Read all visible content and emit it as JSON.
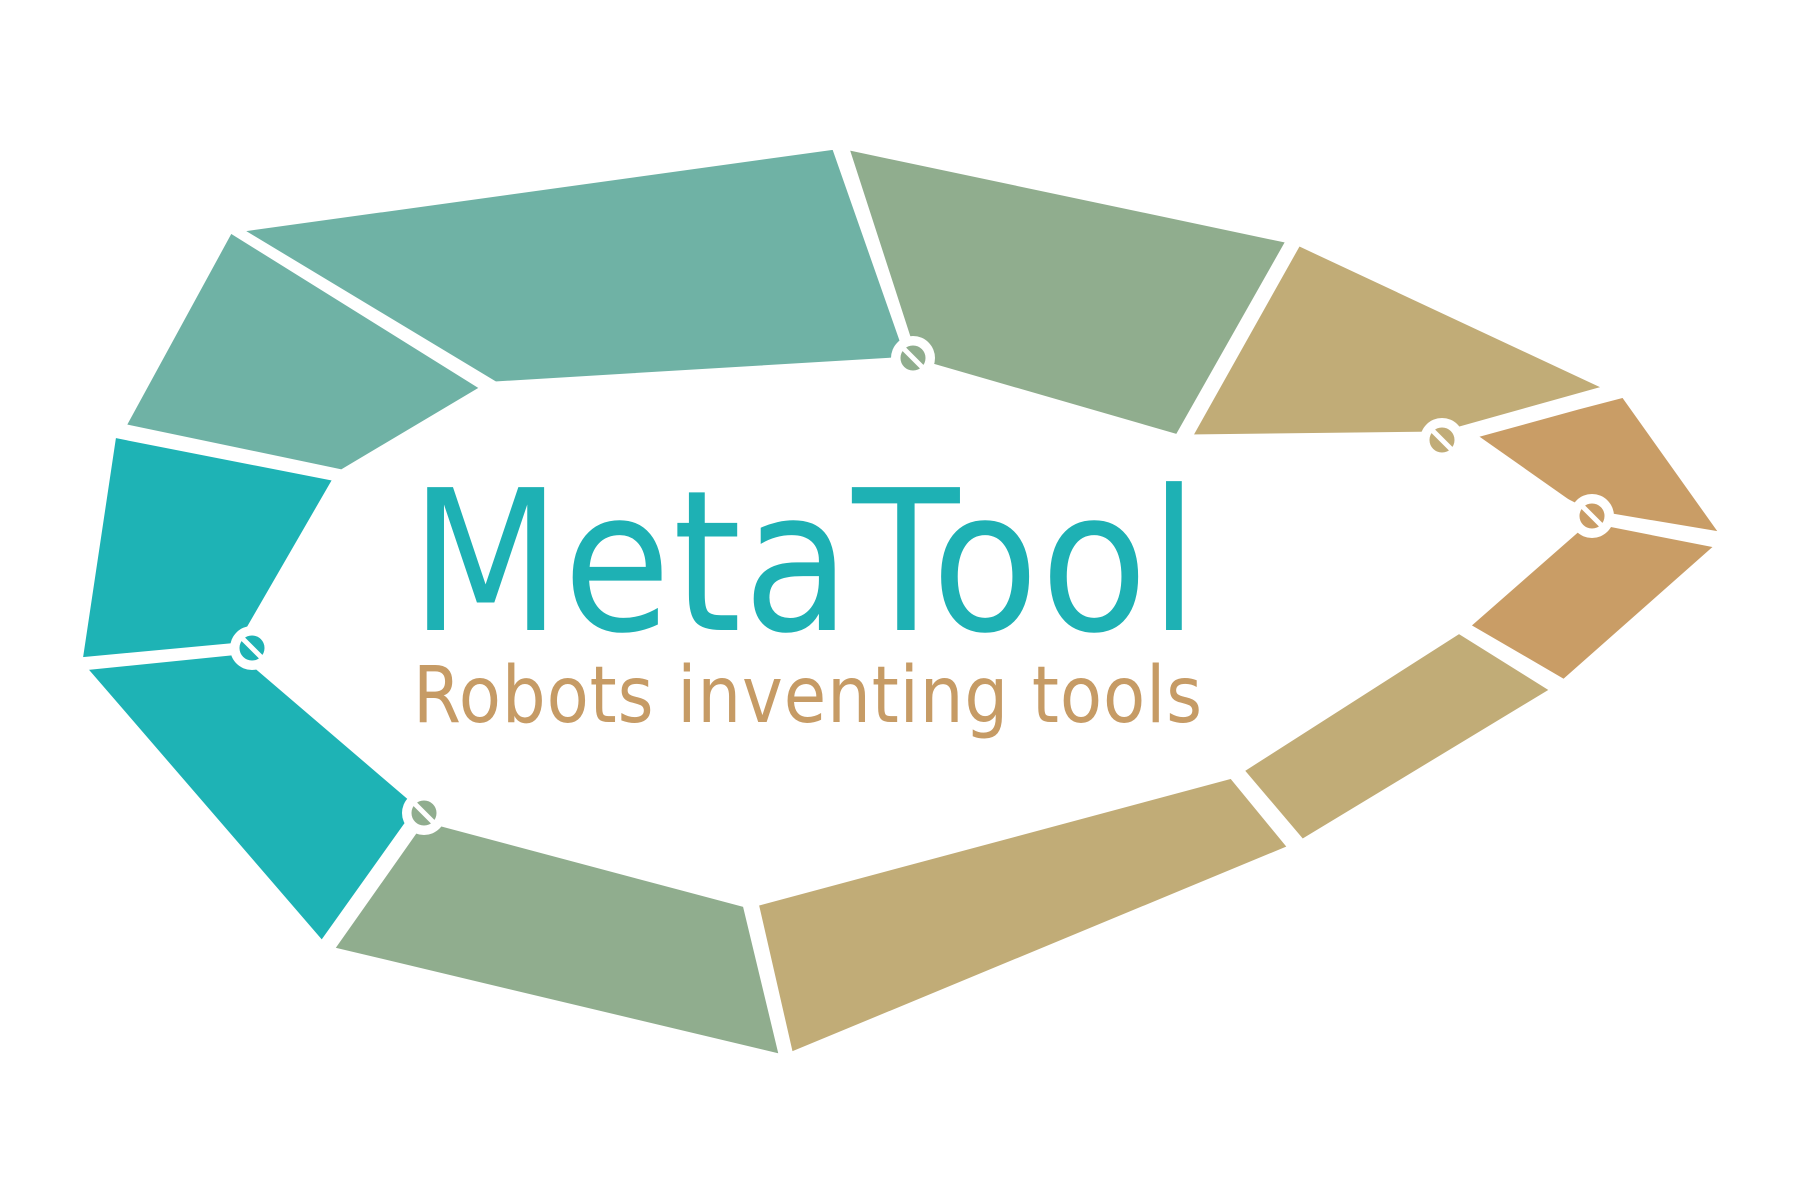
{
  "logo": {
    "name": "MetaTool",
    "tagline": "Robots inventing tools"
  },
  "colors": {
    "background": "#ffffff",
    "name_text": "#1eb1b4",
    "tagline_text": "#c69b65",
    "segment_teal": "#1eb3b5",
    "segment_teal_light": "#6fb2a5",
    "segment_sage": "#90ad8e",
    "segment_khaki": "#c1ac77",
    "segment_ochre": "#c99d66",
    "outline": "#ffffff"
  },
  "icons": [
    "joint-icon"
  ]
}
